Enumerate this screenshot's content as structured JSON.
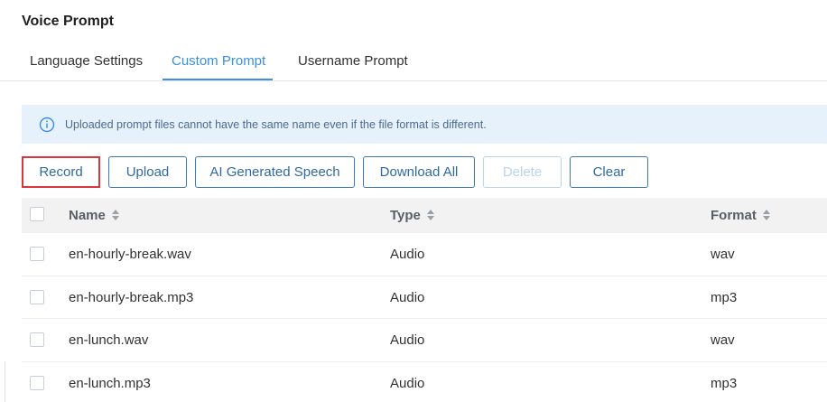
{
  "page": {
    "title": "Voice Prompt"
  },
  "tabs": [
    {
      "label": "Language Settings",
      "active": false
    },
    {
      "label": "Custom Prompt",
      "active": true
    },
    {
      "label": "Username Prompt",
      "active": false
    }
  ],
  "notice": {
    "icon": "info-icon",
    "text": "Uploaded prompt files cannot have the same name even if the file format is different."
  },
  "toolbar": {
    "record": "Record",
    "upload": "Upload",
    "ai_speech": "AI Generated Speech",
    "download_all": "Download All",
    "delete": "Delete",
    "clear": "Clear"
  },
  "table": {
    "headers": {
      "name": "Name",
      "type": "Type",
      "format": "Format"
    },
    "rows": [
      {
        "name": "en-hourly-break.wav",
        "type": "Audio",
        "format": "wav"
      },
      {
        "name": "en-hourly-break.mp3",
        "type": "Audio",
        "format": "mp3"
      },
      {
        "name": "en-lunch.wav",
        "type": "Audio",
        "format": "wav"
      },
      {
        "name": "en-lunch.mp3",
        "type": "Audio",
        "format": "mp3"
      }
    ]
  },
  "colors": {
    "accent": "#3a8ee6",
    "button_border": "#3a7ab8",
    "highlight_red": "#d9363e",
    "notice_bg": "#e6f1fc",
    "header_bg": "#f2f2f2"
  }
}
